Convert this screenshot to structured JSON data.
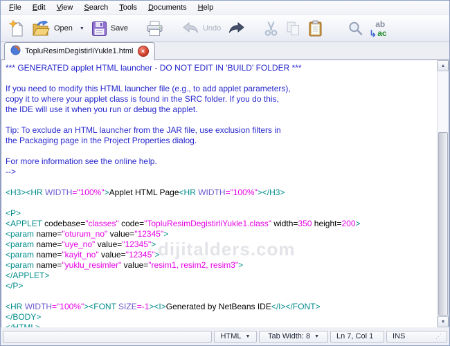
{
  "menu": {
    "items": [
      "File",
      "Edit",
      "View",
      "Search",
      "Tools",
      "Documents",
      "Help"
    ]
  },
  "toolbar": {
    "buttons": [
      {
        "name": "new",
        "icon": "new-document-icon",
        "label": "",
        "disabled": false
      },
      {
        "name": "open",
        "icon": "open-folder-icon",
        "label": "Open",
        "dropdown": true,
        "disabled": false
      },
      {
        "name": "save",
        "icon": "save-floppy-icon",
        "label": "Save",
        "disabled": false
      },
      {
        "name": "print",
        "icon": "print-icon",
        "label": "",
        "disabled": false
      },
      {
        "name": "undo",
        "icon": "undo-icon",
        "label": "Undo",
        "disabled": true
      },
      {
        "name": "redo",
        "icon": "redo-icon",
        "label": "",
        "disabled": false
      },
      {
        "name": "cut",
        "icon": "cut-icon",
        "label": "",
        "disabled": true
      },
      {
        "name": "copy",
        "icon": "copy-icon",
        "label": "",
        "disabled": true
      },
      {
        "name": "paste",
        "icon": "paste-icon",
        "label": "",
        "disabled": false
      },
      {
        "name": "find",
        "icon": "find-icon",
        "label": "",
        "disabled": false
      },
      {
        "name": "replace",
        "icon": "replace-icon",
        "label": "",
        "disabled": false
      }
    ]
  },
  "tab": {
    "title": "TopluResimDegistirliYukle1.html"
  },
  "editor": {
    "watermark": "dijitalders.com",
    "lines": [
      [
        [
          "cm",
          "*** GENERATED applet HTML launcher - DO NOT EDIT IN 'BUILD' FOLDER ***"
        ]
      ],
      [],
      [
        [
          "cm",
          "If you need to modify this HTML launcher file (e.g., to add applet parameters),"
        ]
      ],
      [
        [
          "cm",
          "copy it to where your applet class is found in the SRC folder. If you do this,"
        ]
      ],
      [
        [
          "cm",
          "the IDE will use it when you run or debug the applet."
        ]
      ],
      [],
      [
        [
          "cm",
          "Tip: To exclude an HTML launcher from the JAR file, use exclusion filters in"
        ]
      ],
      [
        [
          "cm",
          "the Packaging page in the Project Properties dialog."
        ]
      ],
      [],
      [
        [
          "cm",
          "For more information see the online help."
        ]
      ],
      [
        [
          "cm",
          "-->"
        ]
      ],
      [],
      [
        [
          "tag",
          "<H3><HR "
        ],
        [
          "att",
          "WIDTH"
        ],
        [
          "val",
          "=\"100%\""
        ],
        [
          "tag",
          ">"
        ],
        [
          "txt",
          "Applet HTML Page"
        ],
        [
          "tag",
          "<HR "
        ],
        [
          "att",
          "WIDTH"
        ],
        [
          "val",
          "=\"100%\""
        ],
        [
          "tag",
          "></H3>"
        ]
      ],
      [],
      [
        [
          "tag",
          "<P>"
        ]
      ],
      [
        [
          "tag",
          "<APPLET"
        ],
        [
          "txt",
          " codebase="
        ],
        [
          "val",
          "\"classes\""
        ],
        [
          "txt",
          " code="
        ],
        [
          "val",
          "\"TopluResimDegistirliYukle1.class\""
        ],
        [
          "txt",
          " width="
        ],
        [
          "val",
          "350"
        ],
        [
          "txt",
          " height="
        ],
        [
          "val",
          "200"
        ],
        [
          "tag",
          ">"
        ]
      ],
      [
        [
          "tag",
          "<param"
        ],
        [
          "txt",
          " name="
        ],
        [
          "val",
          "\"oturum_no\""
        ],
        [
          "txt",
          " value="
        ],
        [
          "val",
          "\"12345\""
        ],
        [
          "tag",
          ">"
        ]
      ],
      [
        [
          "tag",
          "<param"
        ],
        [
          "txt",
          " name="
        ],
        [
          "val",
          "\"uye_no\""
        ],
        [
          "txt",
          " value="
        ],
        [
          "val",
          "\"12345\""
        ],
        [
          "tag",
          ">"
        ]
      ],
      [
        [
          "tag",
          "<param"
        ],
        [
          "txt",
          " name="
        ],
        [
          "val",
          "\"kayit_no\""
        ],
        [
          "txt",
          " value="
        ],
        [
          "val",
          "\"12345\""
        ],
        [
          "tag",
          ">"
        ]
      ],
      [
        [
          "tag",
          "<param"
        ],
        [
          "txt",
          " name="
        ],
        [
          "val",
          "\"yuklu_resimler\""
        ],
        [
          "txt",
          " value="
        ],
        [
          "val",
          "\"resim1, resim2, resim3\""
        ],
        [
          "tag",
          ">"
        ]
      ],
      [
        [
          "tag",
          "</APPLET>"
        ]
      ],
      [
        [
          "tag",
          "</P>"
        ]
      ],
      [],
      [
        [
          "tag",
          "<HR "
        ],
        [
          "att",
          "WIDTH"
        ],
        [
          "val",
          "=\"100%\""
        ],
        [
          "tag",
          "><FONT "
        ],
        [
          "att",
          "SIZE"
        ],
        [
          "val",
          "=-1"
        ],
        [
          "tag",
          "><I>"
        ],
        [
          "txt",
          "Generated by NetBeans IDE"
        ],
        [
          "tag",
          "</I></FONT>"
        ]
      ],
      [
        [
          "tag",
          "</BODY>"
        ]
      ],
      [
        [
          "tag",
          "</HTML>"
        ]
      ]
    ]
  },
  "statusbar": {
    "language": "HTML",
    "tab_width": "Tab Width: 8",
    "position": "Ln 7, Col 1",
    "mode": "INS"
  },
  "colors": {
    "cm": "#2626cd",
    "tag": "#008b8b",
    "att": "#6a5acd",
    "val": "#e600e6",
    "txt": "#000000"
  }
}
